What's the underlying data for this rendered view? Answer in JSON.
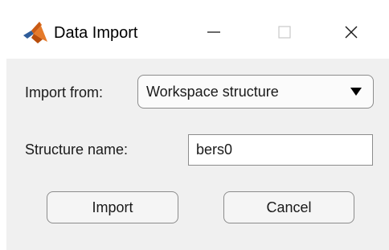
{
  "window": {
    "title": "Data Import",
    "icon": "matlab-membrane-icon",
    "controls": {
      "minimize_glyph": "—",
      "maximize_glyph": "☐",
      "close_glyph": "✕"
    }
  },
  "form": {
    "import_from": {
      "label": "Import from:",
      "selected": "Workspace structure",
      "options": [
        "Workspace structure"
      ]
    },
    "structure_name": {
      "label": "Structure name:",
      "value": "bers0"
    }
  },
  "buttons": {
    "import_label": "Import",
    "cancel_label": "Cancel"
  },
  "colors": {
    "client_background": "#f0f0f0",
    "titlebar_background": "#ffffff",
    "border": "#8c8c8c",
    "icon_orange": "#e06c1a",
    "icon_blue": "#2f5d9a"
  }
}
